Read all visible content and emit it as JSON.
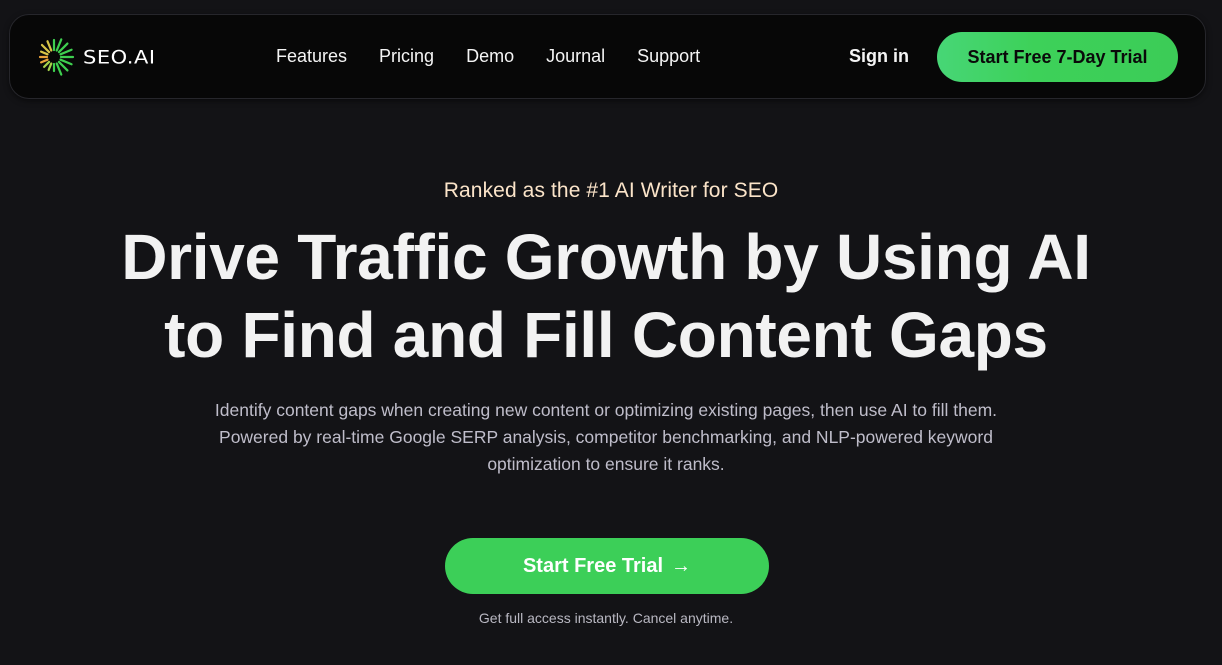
{
  "brand": {
    "name": "SEO.AI",
    "logo_icon": "sunburst-logo-icon",
    "colors": {
      "accent_green": "#3ccf58",
      "eyebrow_cream": "#fbe4c9",
      "background": "#131316",
      "navbar_bg": "#070707"
    }
  },
  "nav": {
    "links": [
      {
        "label": "Features"
      },
      {
        "label": "Pricing"
      },
      {
        "label": "Demo"
      },
      {
        "label": "Journal"
      },
      {
        "label": "Support"
      }
    ],
    "sign_in": "Sign in",
    "cta": "Start Free 7-Day Trial"
  },
  "hero": {
    "eyebrow": "Ranked as the #1 AI Writer for SEO",
    "headline_line1": "Drive Traffic Growth by Using AI",
    "headline_line2": "to Find and Fill Content Gaps",
    "subtext": "Identify content gaps when creating new content or optimizing existing pages, then use AI to fill them. Powered by real-time Google SERP analysis, competitor benchmarking, and NLP-powered keyword optimization to ensure it ranks.",
    "cta_label": "Start Free Trial",
    "cta_icon": "→",
    "fineprint": "Get full access instantly. Cancel anytime."
  }
}
